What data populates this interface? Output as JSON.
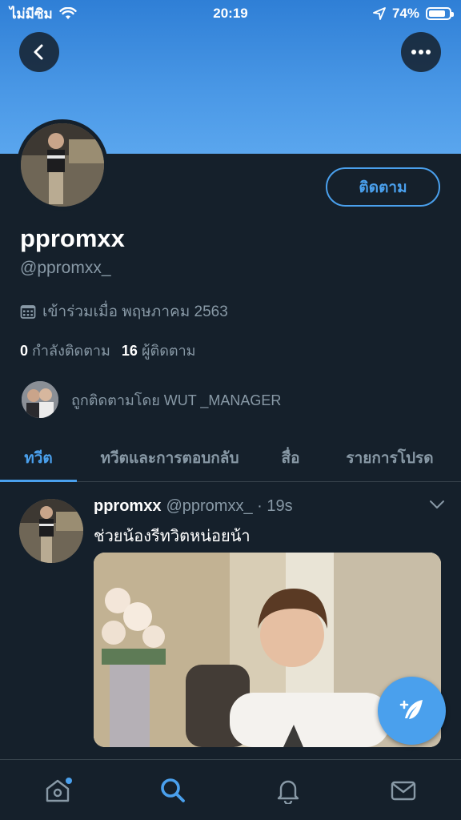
{
  "status_bar": {
    "carrier": "ไม่มีซิม",
    "time": "20:19",
    "battery": "74%",
    "battery_level": 0.74
  },
  "profile": {
    "follow_label": "ติดตาม",
    "display_name": "ppromxx",
    "handle": "@ppromxx_",
    "joined": "เข้าร่วมเมื่อ พฤษภาคม 2563",
    "following_count": "0",
    "following_label": "กำลังติดตาม",
    "followers_count": "16",
    "followers_label": "ผู้ติดตาม",
    "followed_by": "ถูกติดตามโดย WUT _MANAGER"
  },
  "tabs": [
    {
      "label": "ทวีต",
      "active": true
    },
    {
      "label": "ทวีตและการตอบกลับ",
      "active": false
    },
    {
      "label": "สื่อ",
      "active": false
    },
    {
      "label": "รายการโปรด",
      "active": false
    }
  ],
  "tweet": {
    "name": "ppromxx",
    "meta": "@ppromxx_ · 19s",
    "text": "ช่วยน้องรีทวิตหน่อยน้า"
  },
  "nav": {
    "items": [
      "home-icon",
      "search-icon",
      "notifications-icon",
      "messages-icon"
    ],
    "active": "search-icon"
  },
  "colors": {
    "background": "#15202b",
    "accent": "#4aa0ed",
    "muted": "#8899a6",
    "banner": "#4a98e6"
  }
}
